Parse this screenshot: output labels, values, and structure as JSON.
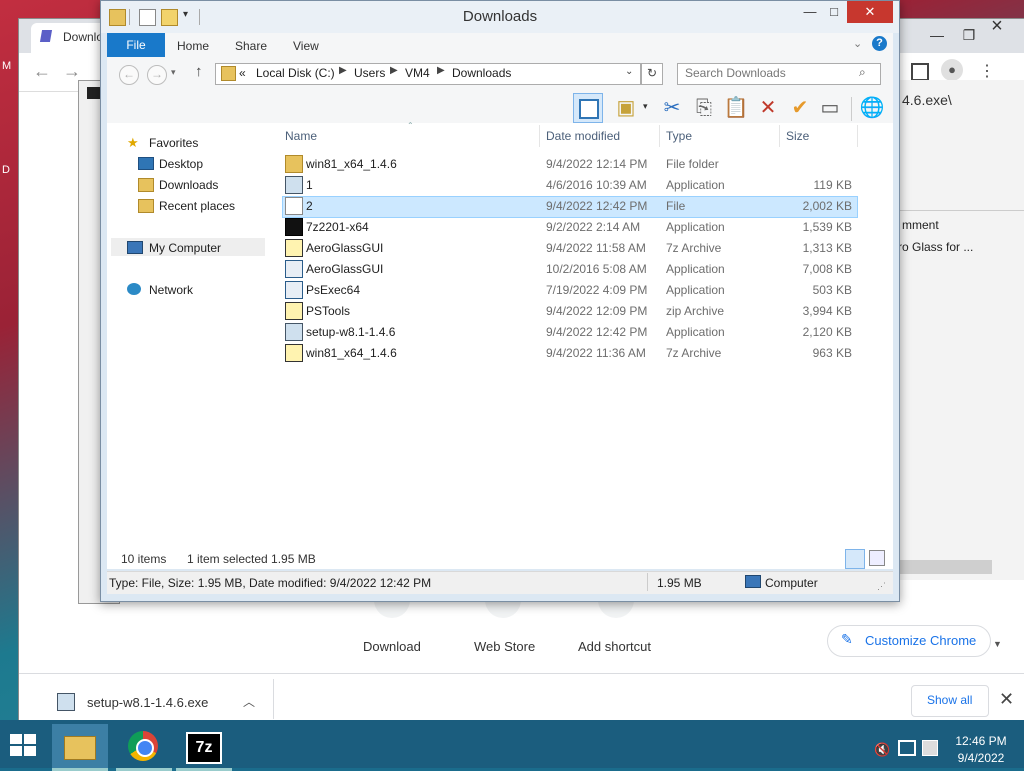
{
  "chrome": {
    "tab_title": "Downlo",
    "addr_fragment": "4.6.exe\\",
    "column_comment": "mment",
    "row_desc": "ro Glass for ...",
    "shortcuts": [
      "Download",
      "Web Store",
      "Add shortcut"
    ],
    "customize_label": "Customize Chrome",
    "download_file": "setup-w8.1-1.4.6.exe",
    "show_all": "Show all"
  },
  "explorer": {
    "title": "Downloads",
    "ribbon_tabs": [
      "File",
      "Home",
      "Share",
      "View"
    ],
    "breadcrumb": [
      "«",
      "Local Disk (C:)",
      "Users",
      "VM4",
      "Downloads"
    ],
    "search_placeholder": "Search Downloads",
    "nav": {
      "favorites": "Favorites",
      "desktop": "Desktop",
      "downloads": "Downloads",
      "recent": "Recent places",
      "computer": "My Computer",
      "network": "Network"
    },
    "columns": [
      "Name",
      "Date modified",
      "Type",
      "Size"
    ],
    "files": [
      {
        "name": "win81_x64_1.4.6",
        "date": "9/4/2022 12:14 PM",
        "type": "File folder",
        "size": "",
        "icon": "folder-icon"
      },
      {
        "name": "1",
        "date": "4/6/2016 10:39 AM",
        "type": "Application",
        "size": "119 KB",
        "icon": "installer-icon"
      },
      {
        "name": "2",
        "date": "9/4/2022 12:42 PM",
        "type": "File",
        "size": "2,002 KB",
        "icon": "blank-file-icon"
      },
      {
        "name": "7z2201-x64",
        "date": "9/2/2022 2:14 AM",
        "type": "Application",
        "size": "1,539 KB",
        "icon": "7zip-app-icon"
      },
      {
        "name": "AeroGlassGUI",
        "date": "9/4/2022 11:58 AM",
        "type": "7z Archive",
        "size": "1,313 KB",
        "icon": "archive-icon"
      },
      {
        "name": "AeroGlassGUI",
        "date": "10/2/2016 5:08 AM",
        "type": "Application",
        "size": "7,008 KB",
        "icon": "app-window-icon"
      },
      {
        "name": "PsExec64",
        "date": "7/19/2022 4:09 PM",
        "type": "Application",
        "size": "503 KB",
        "icon": "app-window-icon"
      },
      {
        "name": "PSTools",
        "date": "9/4/2022 12:09 PM",
        "type": "zip Archive",
        "size": "3,994 KB",
        "icon": "archive-icon"
      },
      {
        "name": "setup-w8.1-1.4.6",
        "date": "9/4/2022 12:42 PM",
        "type": "Application",
        "size": "2,120 KB",
        "icon": "installer-icon"
      },
      {
        "name": "win81_x64_1.4.6",
        "date": "9/4/2022 11:36 AM",
        "type": "7z Archive",
        "size": "963 KB",
        "icon": "archive-icon"
      }
    ],
    "status": {
      "count": "10 items",
      "selected": "1 item selected  1.95 MB"
    },
    "details": {
      "info": "Type: File, Size: 1.95 MB, Date modified: 9/4/2022 12:42 PM",
      "size": "1.95 MB",
      "location": "Computer"
    }
  },
  "taskbar": {
    "time": "12:46 PM",
    "date": "9/4/2022"
  },
  "colors": {
    "file_tab": "#1979ca",
    "selection": "#cce8ff",
    "close": "#c7372e",
    "taskbar": "#1b5d7e"
  }
}
